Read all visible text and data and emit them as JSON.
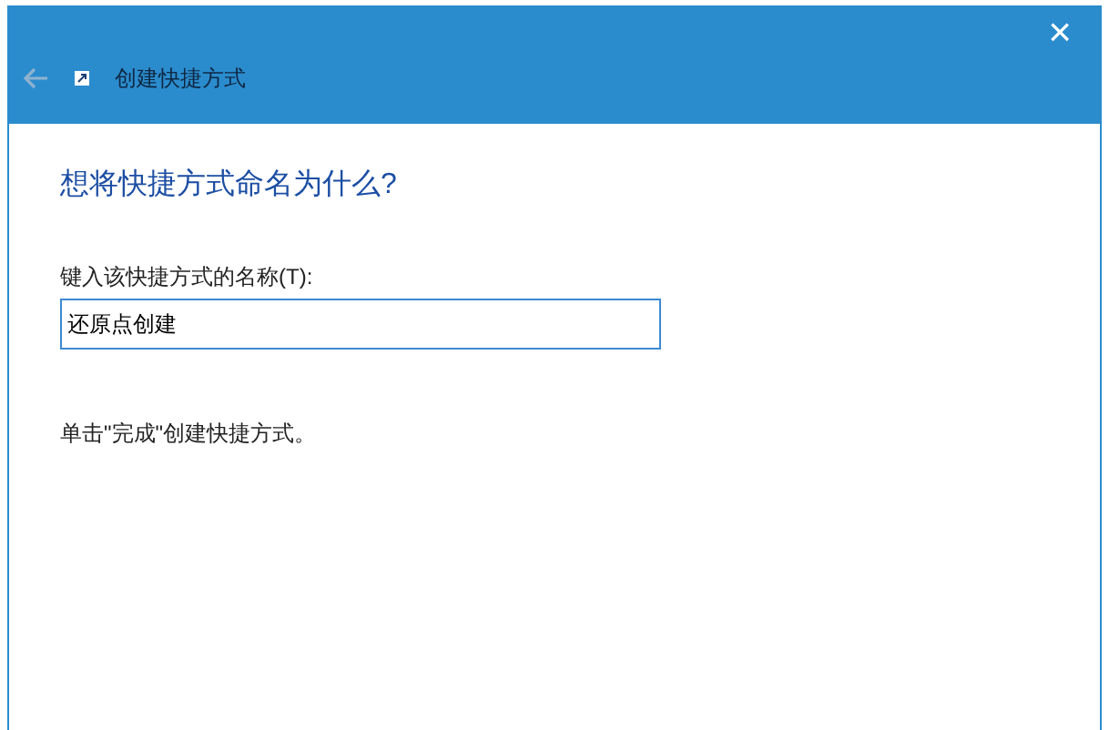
{
  "window": {
    "title": "创建快捷方式",
    "close": "×"
  },
  "heading": "想将快捷方式命名为什么?",
  "name_field": {
    "label": "键入该快捷方式的名称(T):",
    "value": "还原点创建"
  },
  "hint": "单击\"完成\"创建快捷方式。"
}
